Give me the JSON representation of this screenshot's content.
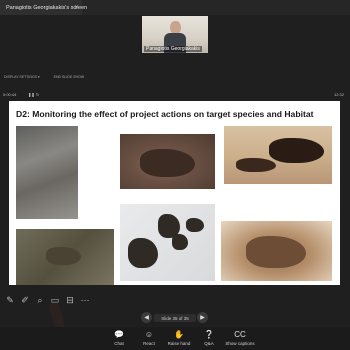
{
  "window": {
    "tab_title": "Panagiotis Georgiakakis's screen",
    "tab_close": "✕"
  },
  "video": {
    "participant_name": "Panagiotis Georgiakakis"
  },
  "controls": {
    "display_settings": "DISPLAY SETTINGS ▾",
    "end_slide_show": "END SLIDE SHOW"
  },
  "presenter": {
    "timer": "0:00:44",
    "clock": "12:32"
  },
  "slide": {
    "title": "D2: Monitoring the effect of project actions on target species and Habitat"
  },
  "navigation": {
    "prev": "◀",
    "next": "▶",
    "slide_counter": "Slide 35 of 35"
  },
  "drawing_tools": [
    {
      "name": "pen-icon",
      "glyph": "✎"
    },
    {
      "name": "laser-pointer-icon",
      "glyph": "✐"
    },
    {
      "name": "zoom-icon",
      "glyph": "⌕"
    },
    {
      "name": "screen-icon",
      "glyph": "▭"
    },
    {
      "name": "subtitles-icon",
      "glyph": "⊟"
    },
    {
      "name": "more-options-icon",
      "glyph": "⋯"
    }
  ],
  "meeting_toolbar": [
    {
      "name": "chat",
      "icon": "💬",
      "label": "Chat"
    },
    {
      "name": "react",
      "icon": "☺",
      "label": "React"
    },
    {
      "name": "raise-hand",
      "icon": "✋",
      "label": "Raise hand"
    },
    {
      "name": "qna",
      "icon": "❔",
      "label": "Q&A"
    },
    {
      "name": "show-captions",
      "icon": "CC",
      "label": "Show captions"
    }
  ]
}
